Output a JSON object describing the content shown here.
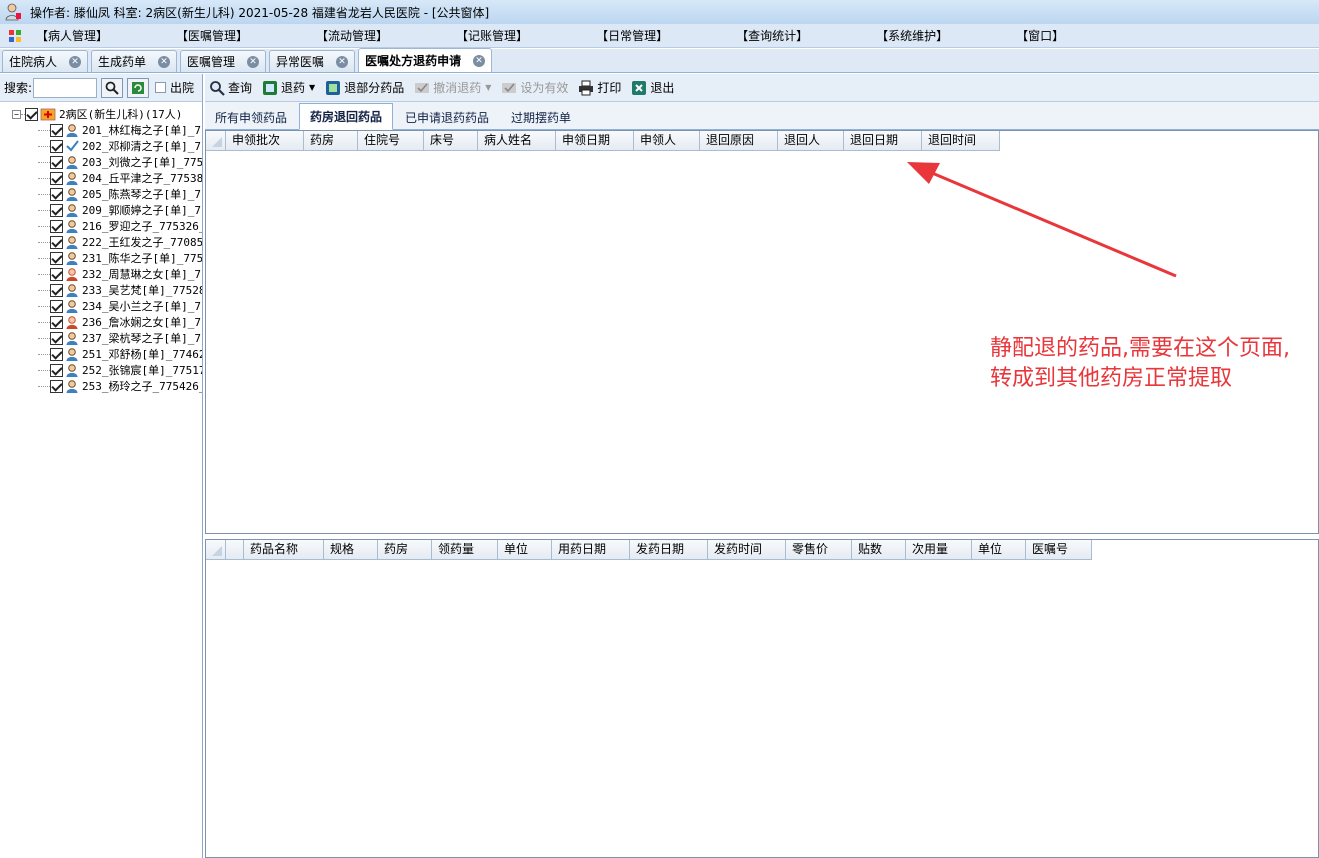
{
  "title": "操作者: 滕仙凤  科室: 2病区(新生儿科)  2021-05-28  福建省龙岩人民医院 - [公共窗体]",
  "menu": [
    "【病人管理】",
    "【医嘱管理】",
    "【流动管理】",
    "【记账管理】",
    "【日常管理】",
    "【查询统计】",
    "【系统维护】",
    "【窗口】"
  ],
  "tabs": [
    "住院病人",
    "生成药单",
    "医嘱管理",
    "异常医嘱",
    "医嘱处方退药申请"
  ],
  "left": {
    "search_label": "搜索:",
    "search_value": "",
    "discharge_label": "出院",
    "root": "2病区(新生儿科)(17人)",
    "patients": [
      {
        "label": "201_林红梅之子[单]_7",
        "gender": "male"
      },
      {
        "label": "202_邓柳清之子[单]_7",
        "gender": "check"
      },
      {
        "label": "203_刘微之子[单]_775",
        "gender": "male"
      },
      {
        "label": "204_丘平津之子_77538",
        "gender": "male"
      },
      {
        "label": "205_陈燕琴之子[单]_7",
        "gender": "male"
      },
      {
        "label": "209_郭顺婷之子[单]_7",
        "gender": "male"
      },
      {
        "label": "216_罗迎之子_775326_",
        "gender": "male"
      },
      {
        "label": "222_王红发之子_77085",
        "gender": "male"
      },
      {
        "label": "231_陈华之子[单]_775",
        "gender": "male"
      },
      {
        "label": "232_周慧琳之女[单]_7",
        "gender": "female"
      },
      {
        "label": "233_吴艺梵[单]_77528",
        "gender": "male"
      },
      {
        "label": "234_吴小兰之子[单]_7",
        "gender": "male"
      },
      {
        "label": "236_詹冰娴之女[单]_7",
        "gender": "female"
      },
      {
        "label": "237_梁杭琴之子[单]_7",
        "gender": "male"
      },
      {
        "label": "251_邓舒杨[单]_77462",
        "gender": "male"
      },
      {
        "label": "252_张锦宸[单]_77517",
        "gender": "male"
      },
      {
        "label": "253_杨玲之子_775426_",
        "gender": "male"
      }
    ]
  },
  "toolbar": {
    "query": "查询",
    "return_drug": "退药",
    "partial_return": "退部分药品",
    "cancel_return": "撤消退药",
    "set_valid": "设为有效",
    "print": "打印",
    "exit": "退出"
  },
  "subtabs": [
    "所有申领药品",
    "药房退回药品",
    "已申请退药药品",
    "过期摆药单"
  ],
  "grid1_columns": [
    "申领批次",
    "药房",
    "住院号",
    "床号",
    "病人姓名",
    "申领日期",
    "申领人",
    "退回原因",
    "退回人",
    "退回日期",
    "退回时间"
  ],
  "grid2_columns": [
    "药品名称",
    "规格",
    "药房",
    "领药量",
    "单位",
    "用药日期",
    "发药日期",
    "发药时间",
    "零售价",
    "贴数",
    "次用量",
    "单位",
    "医嘱号"
  ],
  "annotation": "静配退的药品,需要在这个页面,转成到其他药房正常提取",
  "colors": {
    "annotation": "#e8363a",
    "title_bg": "#c9def4"
  }
}
